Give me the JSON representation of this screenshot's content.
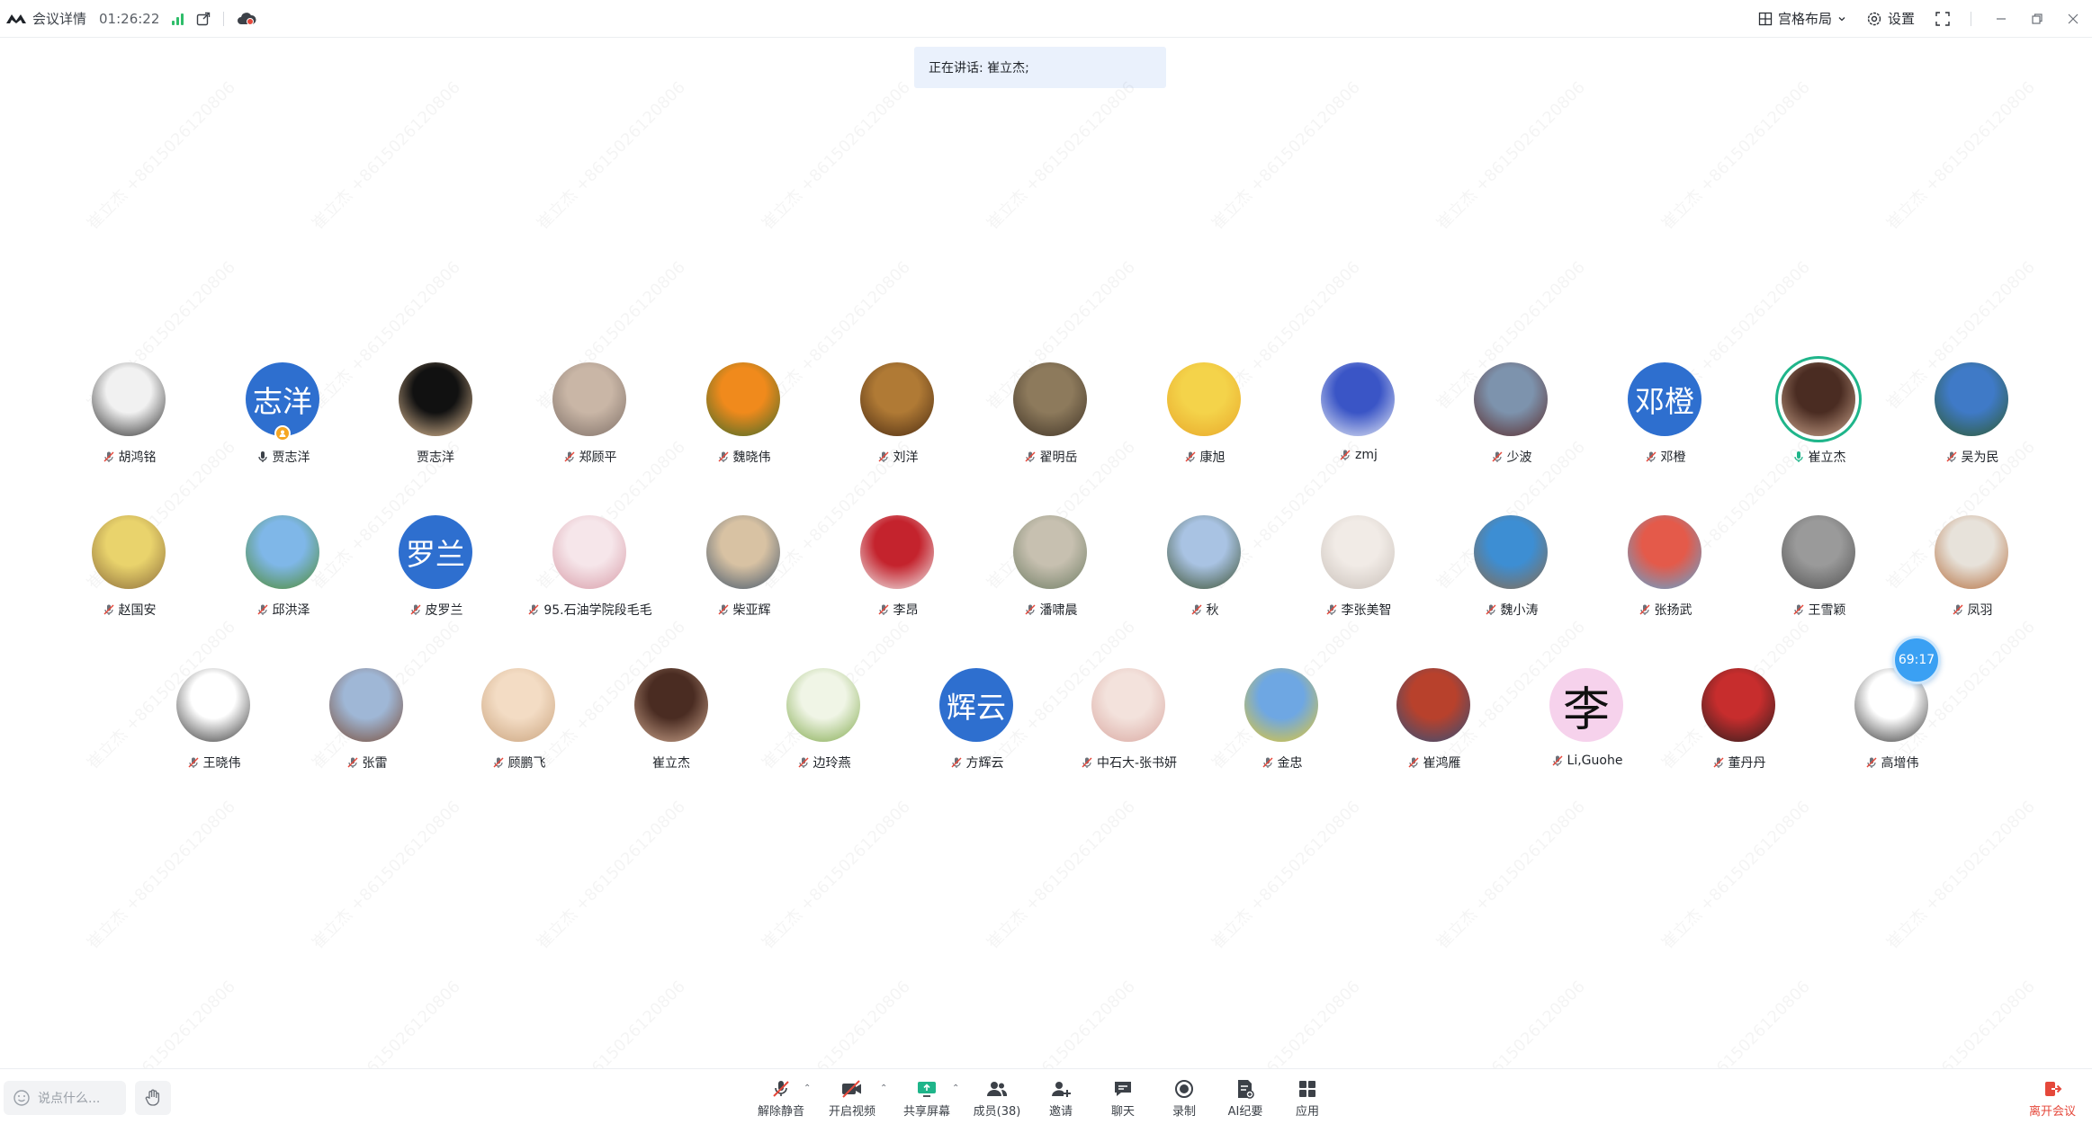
{
  "topbar": {
    "title": "会议详情",
    "duration": "01:26:22",
    "layout_label": "宫格布局",
    "settings_label": "设置"
  },
  "speaking": {
    "text": "正在讲话: 崔立杰;"
  },
  "watermark_text": "崔立杰 +8615026120806",
  "participants": [
    {
      "name": "胡鸿铭",
      "avatar": "photo",
      "colors": [
        "#f1f1f1",
        "#2b2b2b"
      ],
      "mic": "muted"
    },
    {
      "name": "贾志洋",
      "avatar": "text",
      "initials": "志洋",
      "mic": "on",
      "host": true
    },
    {
      "name": "贾志洋",
      "avatar": "photo",
      "colors": [
        "#111111",
        "#e7c39a"
      ],
      "mic": "none"
    },
    {
      "name": "郑顾平",
      "avatar": "photo",
      "colors": [
        "#c9b6a6",
        "#7d6e66"
      ],
      "mic": "muted"
    },
    {
      "name": "魏晓伟",
      "avatar": "photo",
      "colors": [
        "#f08a1c",
        "#3d6a2a"
      ],
      "mic": "muted"
    },
    {
      "name": "刘洋",
      "avatar": "photo",
      "colors": [
        "#b07a35",
        "#4a2b12"
      ],
      "mic": "muted"
    },
    {
      "name": "翟明岳",
      "avatar": "photo",
      "colors": [
        "#8d7a5c",
        "#3f3326"
      ],
      "mic": "muted"
    },
    {
      "name": "康旭",
      "avatar": "photo",
      "colors": [
        "#f4d34a",
        "#e8a72a"
      ],
      "mic": "muted"
    },
    {
      "name": "zmj",
      "avatar": "photo",
      "colors": [
        "#3a55c6",
        "#e9edf7"
      ],
      "mic": "muted"
    },
    {
      "name": "少波",
      "avatar": "photo",
      "colors": [
        "#7d93ad",
        "#5a2a2a"
      ],
      "mic": "muted"
    },
    {
      "name": "邓橙",
      "avatar": "text",
      "initials": "邓橙",
      "mic": "muted"
    },
    {
      "name": "崔立杰",
      "avatar": "photo",
      "colors": [
        "#4a2c22",
        "#cfa88f"
      ],
      "mic": "speaking",
      "active": true
    },
    {
      "name": "吴为民",
      "avatar": "photo",
      "colors": [
        "#3f7ac7",
        "#2f5a2c"
      ],
      "mic": "muted"
    },
    {
      "name": "赵国安",
      "avatar": "photo",
      "colors": [
        "#e9d36c",
        "#8a6a3a"
      ],
      "mic": "muted"
    },
    {
      "name": "邱洪泽",
      "avatar": "photo",
      "colors": [
        "#7fb7e8",
        "#4e8a2c"
      ],
      "mic": "muted"
    },
    {
      "name": "皮罗兰",
      "avatar": "text",
      "initials": "罗兰",
      "mic": "muted"
    },
    {
      "name": "95.石油学院段毛毛",
      "avatar": "photo",
      "colors": [
        "#f6e6ea",
        "#d79aa6"
      ],
      "mic": "muted"
    },
    {
      "name": "柴亚辉",
      "avatar": "photo",
      "colors": [
        "#d8c2a3",
        "#40546a"
      ],
      "mic": "muted"
    },
    {
      "name": "李昂",
      "avatar": "photo",
      "colors": [
        "#c4232d",
        "#f0f0f0"
      ],
      "mic": "muted"
    },
    {
      "name": "潘啸晨",
      "avatar": "photo",
      "colors": [
        "#c7c0b0",
        "#6d7b62"
      ],
      "mic": "muted"
    },
    {
      "name": "秋",
      "avatar": "photo",
      "colors": [
        "#a9c3e3",
        "#3a4f2e"
      ],
      "mic": "muted"
    },
    {
      "name": "李张美智",
      "avatar": "photo",
      "colors": [
        "#f1ebe6",
        "#c8bfb8"
      ],
      "mic": "muted"
    },
    {
      "name": "魏小涛",
      "avatar": "photo",
      "colors": [
        "#3d8ed3",
        "#8a6a4a"
      ],
      "mic": "muted"
    },
    {
      "name": "张扬武",
      "avatar": "photo",
      "colors": [
        "#e45a4a",
        "#5aa8d8"
      ],
      "mic": "muted"
    },
    {
      "name": "王雪颖",
      "avatar": "photo",
      "colors": [
        "#9a9a9a",
        "#505050"
      ],
      "mic": "muted"
    },
    {
      "name": "凤羽",
      "avatar": "photo",
      "colors": [
        "#e7e2da",
        "#b36b3a"
      ],
      "mic": "muted"
    },
    {
      "name": "王晓伟",
      "avatar": "photo",
      "colors": [
        "#ffffff",
        "#333333"
      ],
      "mic": "muted"
    },
    {
      "name": "张雷",
      "avatar": "photo",
      "colors": [
        "#9fb7d6",
        "#7a4b35"
      ],
      "mic": "muted"
    },
    {
      "name": "顾鹏飞",
      "avatar": "photo",
      "colors": [
        "#f3dcc4",
        "#c9a27c"
      ],
      "mic": "muted"
    },
    {
      "name": "崔立杰",
      "avatar": "photo",
      "colors": [
        "#4a2c22",
        "#cfa88f"
      ],
      "mic": "none"
    },
    {
      "name": "边玲燕",
      "avatar": "photo",
      "colors": [
        "#f0f5e6",
        "#7fa84a"
      ],
      "mic": "muted"
    },
    {
      "name": "方辉云",
      "avatar": "text",
      "initials": "辉云",
      "mic": "muted"
    },
    {
      "name": "中石大-张书妍",
      "avatar": "photo",
      "colors": [
        "#f3e2dc",
        "#d9a7a0"
      ],
      "mic": "muted"
    },
    {
      "name": "金忠",
      "avatar": "photo",
      "colors": [
        "#6ea7e3",
        "#e6c92e"
      ],
      "mic": "muted"
    },
    {
      "name": "崔鸿雁",
      "avatar": "photo",
      "colors": [
        "#b8412c",
        "#2f4f7a"
      ],
      "mic": "muted"
    },
    {
      "name": "Li,Guohe",
      "avatar": "text-glyph",
      "initials": "李",
      "mic": "muted"
    },
    {
      "name": "董丹丹",
      "avatar": "photo",
      "colors": [
        "#c72d2d",
        "#2a1e1e"
      ],
      "mic": "muted"
    },
    {
      "name": "高增伟",
      "avatar": "photo",
      "colors": [
        "#ffffff",
        "#333333"
      ],
      "mic": "muted"
    }
  ],
  "timer_bubble": "69:17",
  "bottombar": {
    "chat_placeholder": "说点什么...",
    "tools": [
      {
        "key": "unmute",
        "label": "解除静音",
        "icon": "mic-muted-icon"
      },
      {
        "key": "video",
        "label": "开启视频",
        "icon": "camera-off-icon"
      },
      {
        "key": "share",
        "label": "共享屏幕",
        "icon": "screen-share-icon"
      },
      {
        "key": "members",
        "label": "成员(38)",
        "icon": "members-icon"
      },
      {
        "key": "invite",
        "label": "邀请",
        "icon": "add-user-icon"
      },
      {
        "key": "chat",
        "label": "聊天",
        "icon": "chat-icon"
      },
      {
        "key": "record",
        "label": "录制",
        "icon": "record-icon"
      },
      {
        "key": "ai",
        "label": "AI纪要",
        "icon": "ai-notes-icon"
      },
      {
        "key": "apps",
        "label": "应用",
        "icon": "apps-icon"
      }
    ],
    "leave_label": "离开会议"
  },
  "accent_colors": {
    "avatar_blue": "#2e6fcf",
    "speaking_green": "#1fb58a",
    "leave_red": "#e5483b",
    "timer_blue": "#3aa0f3"
  }
}
